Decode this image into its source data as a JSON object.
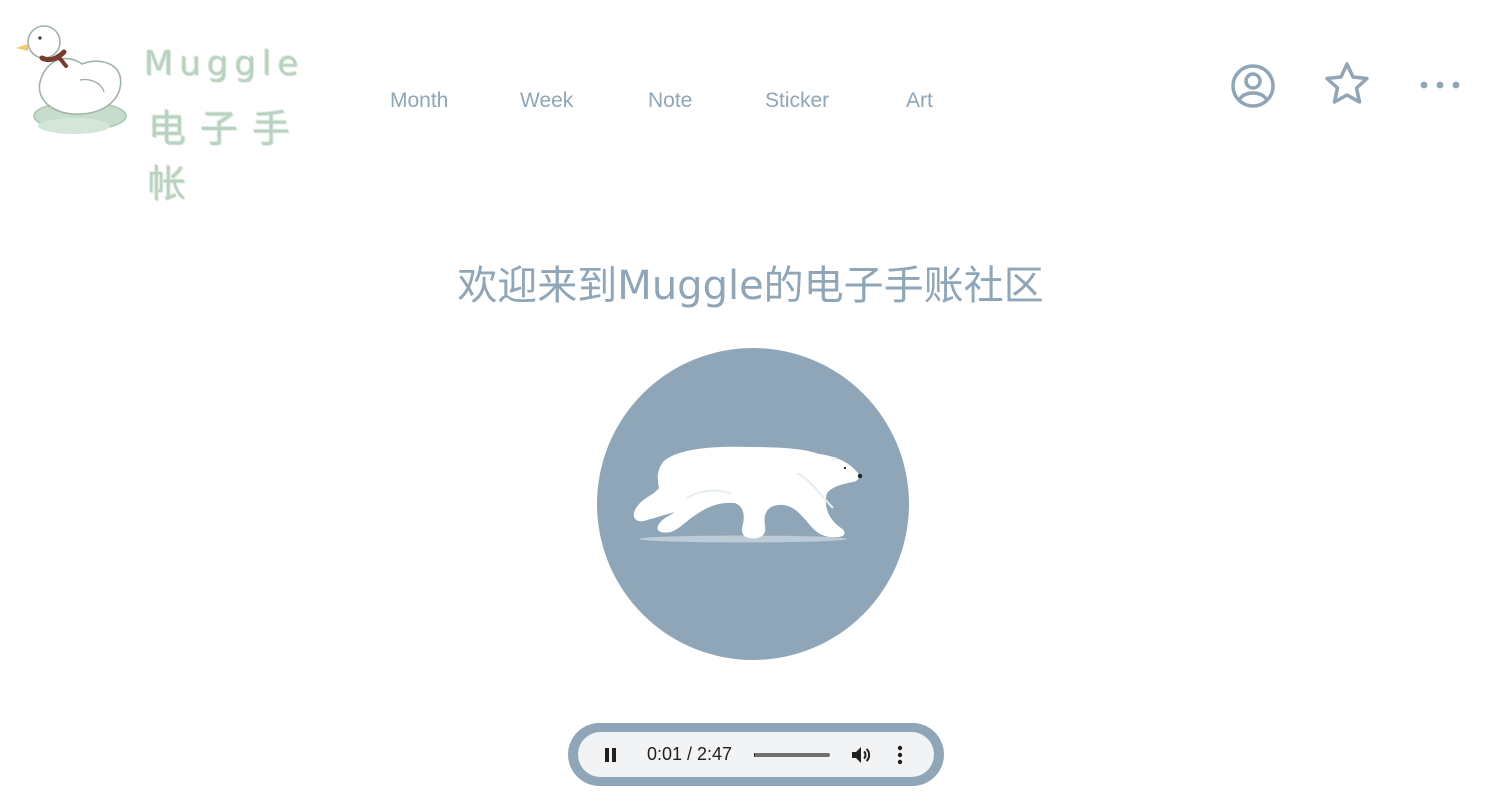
{
  "logo": {
    "title": "Muggle",
    "subtitle": "电子手帐",
    "icon": "duck-mascot-icon"
  },
  "nav": {
    "items": [
      {
        "label": "Month"
      },
      {
        "label": "Week"
      },
      {
        "label": "Note"
      },
      {
        "label": "Sticker"
      },
      {
        "label": "Art"
      }
    ]
  },
  "header_actions": {
    "profile_icon": "user-circle-icon",
    "favorite_icon": "star-icon",
    "more_icon": "more-dots-icon"
  },
  "hero": {
    "welcome_text": "欢迎来到Muggle的电子手账社区",
    "image_icon": "polar-bear-icon"
  },
  "audio": {
    "time_display": "0:01 / 2:47",
    "progress": 0.006,
    "state": "playing"
  },
  "colors": {
    "accent": "#8ea6b7",
    "logo_green": "#b7d3bf",
    "player_bg": "#f1f3f4"
  }
}
